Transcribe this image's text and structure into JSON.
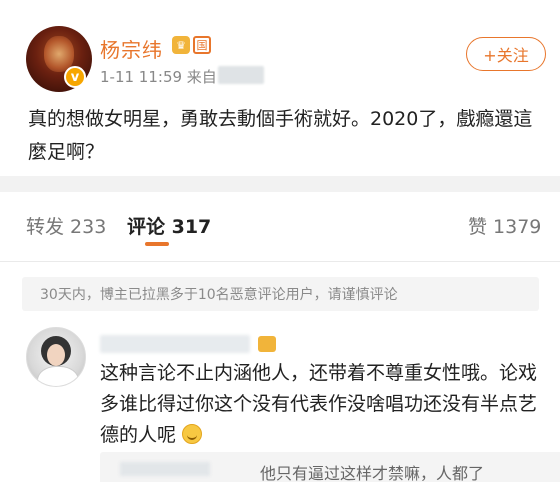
{
  "header": {
    "username": "杨宗纬",
    "meta": "1-11 11:59  来自",
    "follow_label": "+关注",
    "lvl_icon": "crown-icon",
    "cert_icon": "verified-icon"
  },
  "post": {
    "text": "真的想做女明星，勇敢去動個手術就好。2020了，戲瘾還這麼足啊？"
  },
  "tabs": [
    {
      "label": "转发 233"
    },
    {
      "label": "评论 317"
    },
    {
      "label": "赞 1379"
    }
  ],
  "notice": "30天内，博主已拉黑多于10名恶意评论用户，请谨慎评论",
  "comment": {
    "text": "这种言论不止内涵他人，还带着不尊重女性哦。论戏多谁比得过你这个没有代表作没啥唱功还没有半点艺德的人呢",
    "emoji": "smile-emoji"
  },
  "subreply": {
    "text": "他只有逼过这样才禁嘛，人都了"
  }
}
